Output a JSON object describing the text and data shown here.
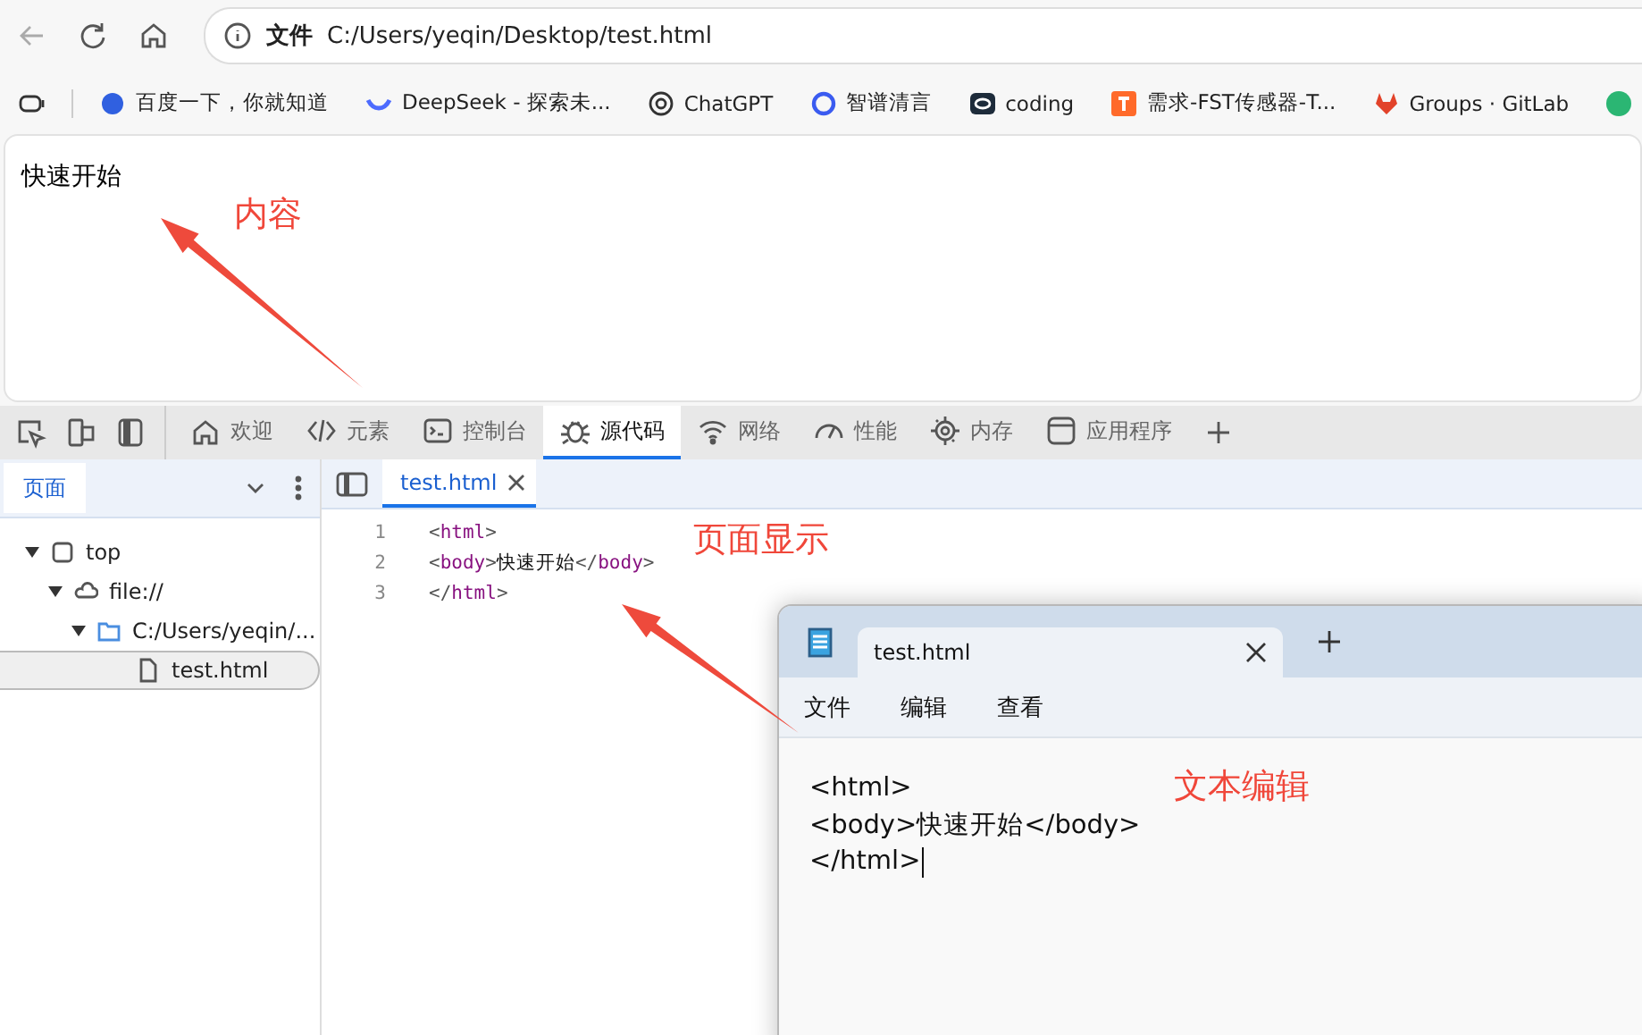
{
  "browser": {
    "address": {
      "scheme_label": "文件",
      "url": "C:/Users/yeqin/Desktop/test.html"
    },
    "bookmarks": [
      {
        "label": "百度一下，你就知道"
      },
      {
        "label": "DeepSeek - 探索未..."
      },
      {
        "label": "ChatGPT"
      },
      {
        "label": "智谱清言"
      },
      {
        "label": "coding"
      },
      {
        "label": "需求-FST传感器-T..."
      },
      {
        "label": "Groups · GitLab"
      }
    ]
  },
  "page_content": {
    "text": "快速开始"
  },
  "devtools": {
    "tabs": [
      {
        "label": "欢迎",
        "selected": false
      },
      {
        "label": "元素",
        "selected": false
      },
      {
        "label": "控制台",
        "selected": false
      },
      {
        "label": "源代码",
        "selected": true
      },
      {
        "label": "网络",
        "selected": false
      },
      {
        "label": "性能",
        "selected": false
      },
      {
        "label": "内存",
        "selected": false
      },
      {
        "label": "应用程序",
        "selected": false
      }
    ],
    "sidebar": {
      "tab": "页面",
      "tree": [
        {
          "label": "top",
          "kind": "frame",
          "selected": false,
          "children": [
            {
              "label": "file://",
              "kind": "cloud",
              "selected": false,
              "children": [
                {
                  "label": "C:/Users/yeqin/...",
                  "kind": "folder",
                  "selected": false,
                  "children": [
                    {
                      "label": "test.html",
                      "kind": "file",
                      "selected": true
                    }
                  ]
                }
              ]
            }
          ]
        }
      ]
    },
    "editor": {
      "tab": "test.html",
      "lines": [
        {
          "number": "1",
          "code": "<html>"
        },
        {
          "number": "2",
          "code": "<body>快速开始</body>"
        },
        {
          "number": "3",
          "code": "</html>"
        }
      ]
    }
  },
  "notepad": {
    "tab": "test.html",
    "menu": [
      "文件",
      "编辑",
      "查看"
    ],
    "lines": [
      "<html>",
      "<body>快速开始</body>",
      "</html>"
    ]
  },
  "annotations": [
    {
      "text": "内容"
    },
    {
      "text": "页面显示"
    },
    {
      "text": "文本编辑"
    }
  ]
}
